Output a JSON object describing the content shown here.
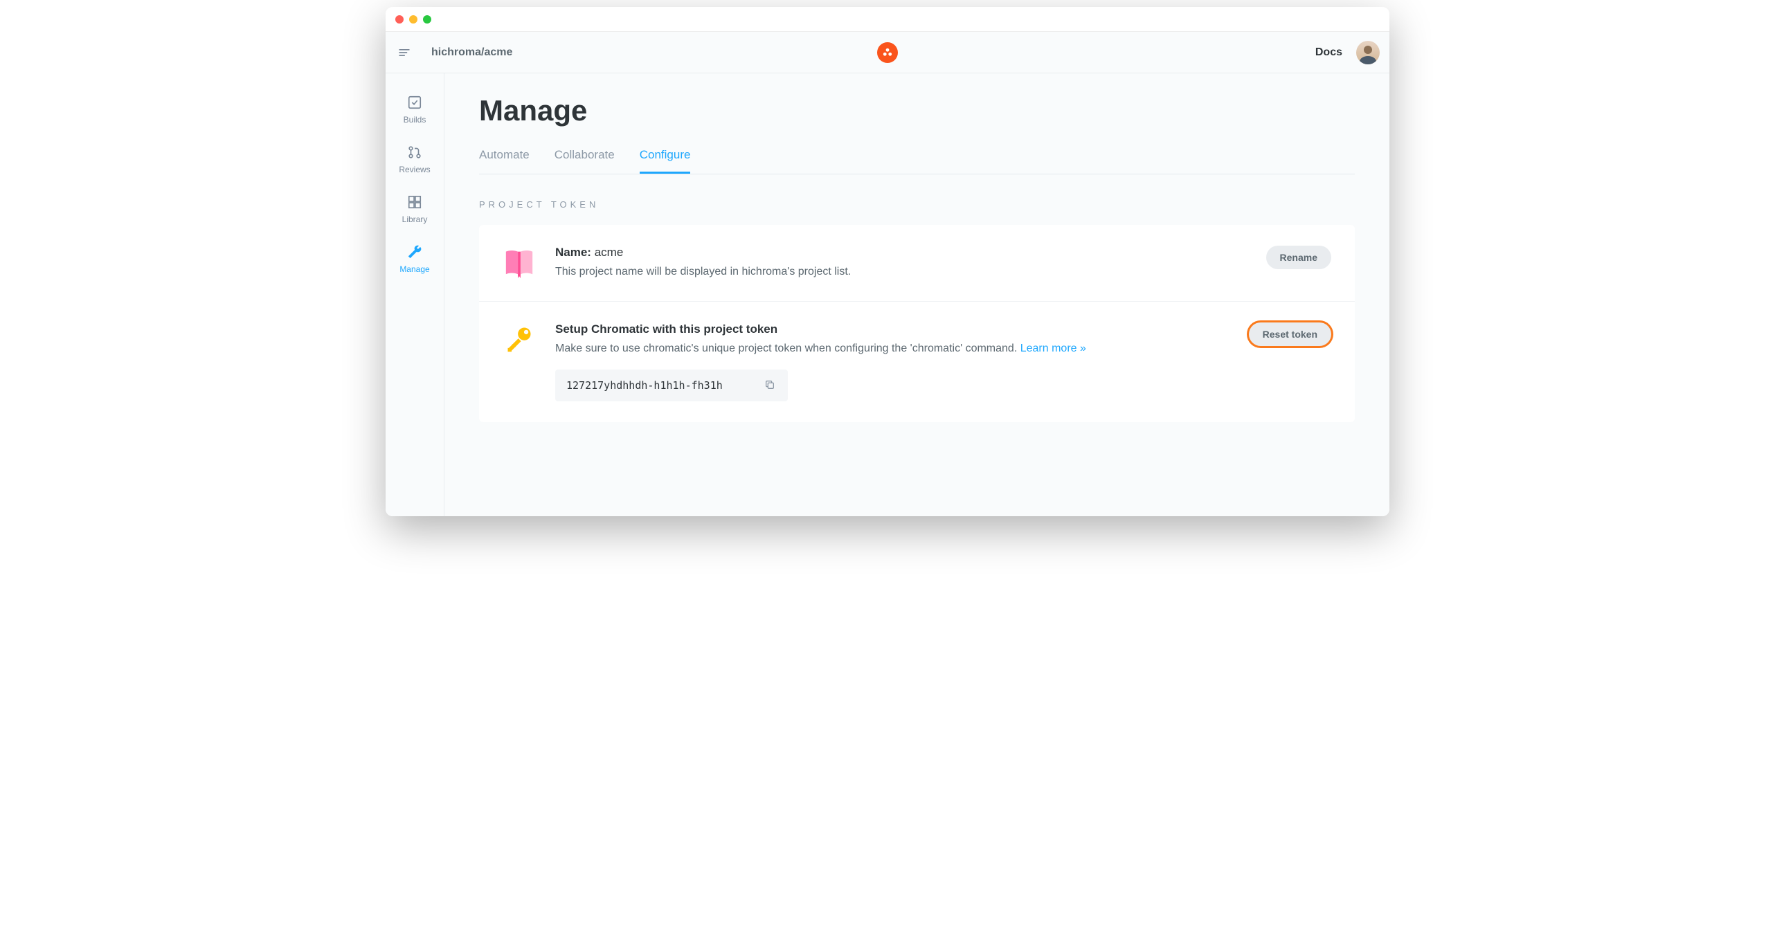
{
  "header": {
    "breadcrumb": "hichroma/acme",
    "docs_label": "Docs"
  },
  "sidebar": {
    "items": [
      {
        "label": "Builds"
      },
      {
        "label": "Reviews"
      },
      {
        "label": "Library"
      },
      {
        "label": "Manage"
      }
    ]
  },
  "page": {
    "title": "Manage"
  },
  "tabs": [
    {
      "label": "Automate"
    },
    {
      "label": "Collaborate"
    },
    {
      "label": "Configure"
    }
  ],
  "section": {
    "label": "PROJECT TOKEN"
  },
  "project_name": {
    "name_label": "Name:",
    "name_value": "acme",
    "description": "This project name will be displayed in hichroma's project list.",
    "rename_button": "Rename"
  },
  "token": {
    "title": "Setup Chromatic with this project token",
    "description_pre": "Make sure to use chromatic's unique project token when configuring the 'chromatic' command. ",
    "learn_more": "Learn more »",
    "value": "127217yhdhhdh-h1h1h-fh31h",
    "reset_button": "Reset token"
  }
}
